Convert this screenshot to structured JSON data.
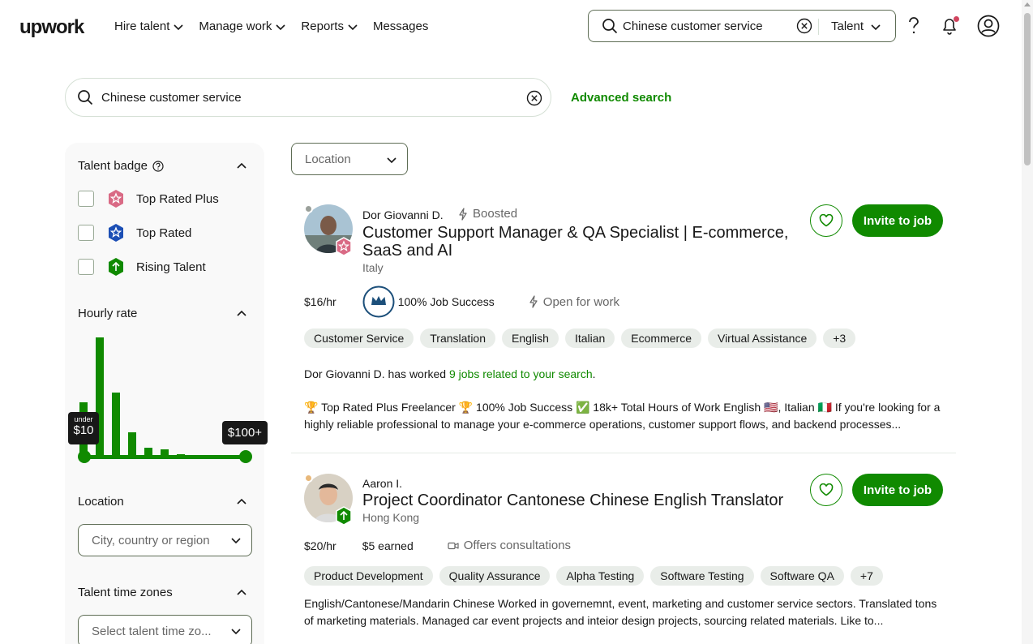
{
  "header": {
    "logo": "upwork",
    "nav": [
      {
        "label": "Hire talent",
        "has_chevron": true
      },
      {
        "label": "Manage work",
        "has_chevron": true
      },
      {
        "label": "Reports",
        "has_chevron": true
      },
      {
        "label": "Messages",
        "has_chevron": false
      }
    ],
    "search_value": "Chinese customer service",
    "search_scope": "Talent"
  },
  "main_search": {
    "value": "Chinese customer service",
    "advanced_label": "Advanced search"
  },
  "filters": {
    "talent_badge": {
      "title": "Talent badge",
      "options": [
        {
          "label": "Top Rated Plus",
          "checked": false,
          "color": "#d96a85"
        },
        {
          "label": "Top Rated",
          "checked": false,
          "color": "#1c4fb5"
        },
        {
          "label": "Rising Talent",
          "checked": false,
          "color": "#108a00"
        }
      ]
    },
    "hourly_rate": {
      "title": "Hourly rate",
      "histogram": [
        46,
        100,
        54,
        21,
        8,
        7,
        3,
        2,
        1,
        1
      ],
      "min_label_small": "under",
      "min_label": "$10",
      "max_label": "$100+"
    },
    "location": {
      "title": "Location",
      "placeholder": "City, country or region"
    },
    "time_zones": {
      "title": "Talent time zones",
      "placeholder": "Select talent time zo..."
    }
  },
  "location_filter": "Location",
  "freelancers": [
    {
      "name": "Dor Giovanni D.",
      "boosted": "Boosted",
      "title": "Customer Support Manager & QA Specialist | E-commerce, SaaS and AI",
      "country": "Italy",
      "badge_color": "#d96a85",
      "rate": "$16/hr",
      "job_success": "100% Job Success",
      "status": "Open for work",
      "skills": [
        "Customer Service",
        "Translation",
        "English",
        "Italian",
        "Ecommerce",
        "Virtual Assistance",
        "+3"
      ],
      "worked_prefix": "Dor Giovanni D. has worked ",
      "worked_link": "9 jobs related to your search",
      "worked_suffix": ".",
      "description": "🏆 Top Rated Plus Freelancer 🏆 100% Job Success ✅ 18k+ Total Hours of Work English 🇺🇸, Italian 🇮🇹 If you're looking for a highly reliable professional to manage your e-commerce operations, customer support flows, and backend processes...",
      "invite_label": "Invite to job"
    },
    {
      "name": "Aaron I.",
      "title": "Project Coordinator Cantonese Chinese English Translator",
      "country": "Hong Kong",
      "badge_color": "#108a00",
      "rate": "$20/hr",
      "earned": "$5 earned",
      "status": "Offers consultations",
      "skills": [
        "Product Development",
        "Quality Assurance",
        "Alpha Testing",
        "Software Testing",
        "Software QA",
        "+7"
      ],
      "description": "English/Cantonese/Mandarin Chinese Worked in governemnt, event, marketing and customer service sectors. Translated tons of marketing materials. Managed car event projects and inteior design projects, sourcing related materials. Like to...",
      "invite_label": "Invite to job"
    }
  ],
  "colors": {
    "brand_green": "#108a00",
    "chip_bg": "#e9ede9",
    "muted_text": "#676767"
  }
}
